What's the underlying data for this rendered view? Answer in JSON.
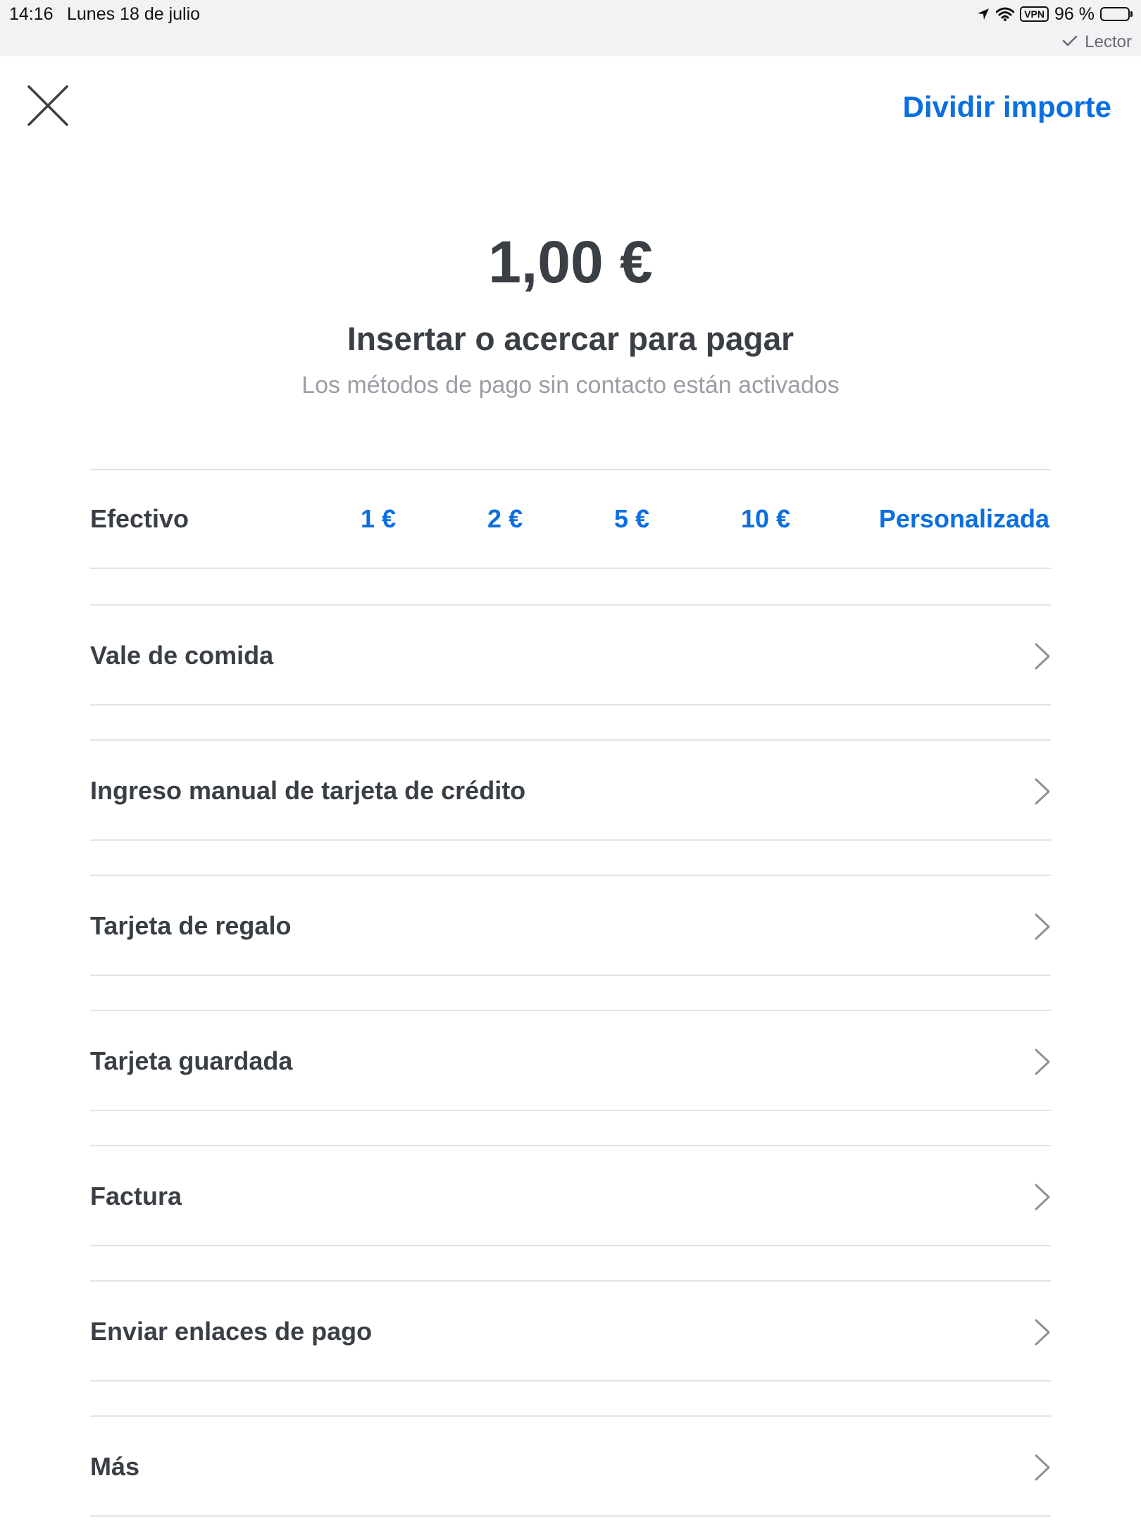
{
  "status_bar": {
    "time": "14:16",
    "date": "Lunes 18 de julio",
    "vpn": "VPN",
    "battery": "96 %",
    "battery_level": 0.96,
    "reader": "Lector",
    "icons": [
      "location-arrow-icon",
      "wifi-icon",
      "vpn-icon",
      "battery-icon",
      "checkmark-icon"
    ]
  },
  "header": {
    "close_icon": "close-icon",
    "split_label": "Dividir importe"
  },
  "payment": {
    "amount": "1,00 €",
    "instruction": "Insertar o acercar para pagar",
    "note": "Los métodos de pago sin contacto están activados"
  },
  "cash": {
    "label": "Efectivo",
    "options": [
      {
        "label": "1 €"
      },
      {
        "label": "2 €"
      },
      {
        "label": "5 €"
      },
      {
        "label": "10 €"
      },
      {
        "label": "Personalizada"
      }
    ]
  },
  "methods": [
    {
      "label": "Vale de comida",
      "icon": "chevron-right-icon"
    },
    {
      "label": "Ingreso manual de tarjeta de crédito",
      "icon": "chevron-right-icon"
    },
    {
      "label": "Tarjeta de regalo",
      "icon": "chevron-right-icon"
    },
    {
      "label": "Tarjeta guardada",
      "icon": "chevron-right-icon"
    },
    {
      "label": "Factura",
      "icon": "chevron-right-icon"
    },
    {
      "label": "Enviar enlaces de pago",
      "icon": "chevron-right-icon"
    },
    {
      "label": "Más",
      "icon": "chevron-right-icon"
    }
  ],
  "colors": {
    "accent": "#0b6fe0",
    "text": "#3a3f46",
    "muted": "#9a9ea4",
    "divider": "#e3e4e6",
    "status_bar_bg": "#f2f2f4"
  }
}
